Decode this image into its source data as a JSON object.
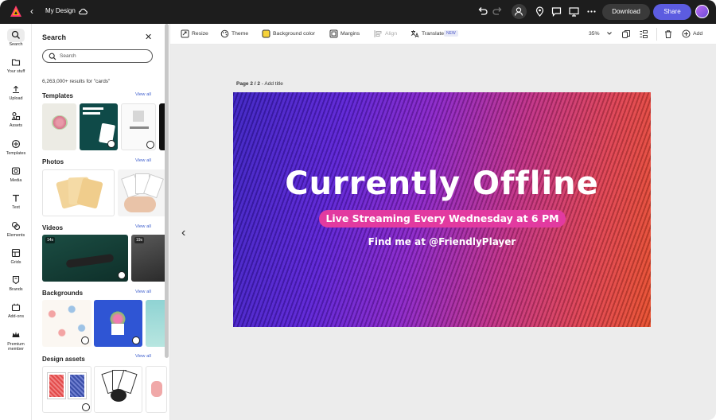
{
  "topbar": {
    "title": "My Design",
    "download_label": "Download",
    "share_label": "Share",
    "colors": {
      "bar": "#1d1d1d",
      "share": "#5c5ce0"
    }
  },
  "rail": {
    "items": [
      {
        "label": "Search",
        "icon": "search-icon"
      },
      {
        "label": "Your stuff",
        "icon": "folder-icon"
      },
      {
        "label": "Upload",
        "icon": "upload-icon"
      },
      {
        "label": "Assets",
        "icon": "shapes-icon"
      },
      {
        "label": "Templates",
        "icon": "templates-icon"
      },
      {
        "label": "Media",
        "icon": "media-icon"
      },
      {
        "label": "Text",
        "icon": "text-icon"
      },
      {
        "label": "Elements",
        "icon": "elements-icon"
      },
      {
        "label": "Grids",
        "icon": "grid-icon"
      },
      {
        "label": "Brands",
        "icon": "brand-icon"
      },
      {
        "label": "Add-ons",
        "icon": "addons-icon"
      },
      {
        "label": "Premium member",
        "icon": "crown-icon"
      }
    ]
  },
  "panel": {
    "title": "Search",
    "search_placeholder": "Search",
    "results": "6,263,000+ results for \"cards\"",
    "sections": [
      {
        "title": "Templates",
        "view_all": "View all"
      },
      {
        "title": "Photos",
        "view_all": "View all"
      },
      {
        "title": "Videos",
        "view_all": "View all"
      },
      {
        "title": "Backgrounds",
        "view_all": "View all"
      },
      {
        "title": "Design assets",
        "view_all": "View all"
      }
    ],
    "video_durations": [
      "14s",
      "19s"
    ]
  },
  "toolbar": {
    "resize": "Resize",
    "theme": "Theme",
    "background_color": "Background color",
    "margins": "Margins",
    "align": "Align",
    "translate": "Translate",
    "new_badge": "NEW",
    "zoom": "35%",
    "add": "Add"
  },
  "canvas": {
    "page_label_bold": "Page 2 / 2",
    "page_label_rest": " - Add title",
    "headline": "Currently Offline",
    "pill_text": "Live Streaming Every Wednesday at 6 PM",
    "subline": "Find me at @FriendlyPlayer"
  }
}
